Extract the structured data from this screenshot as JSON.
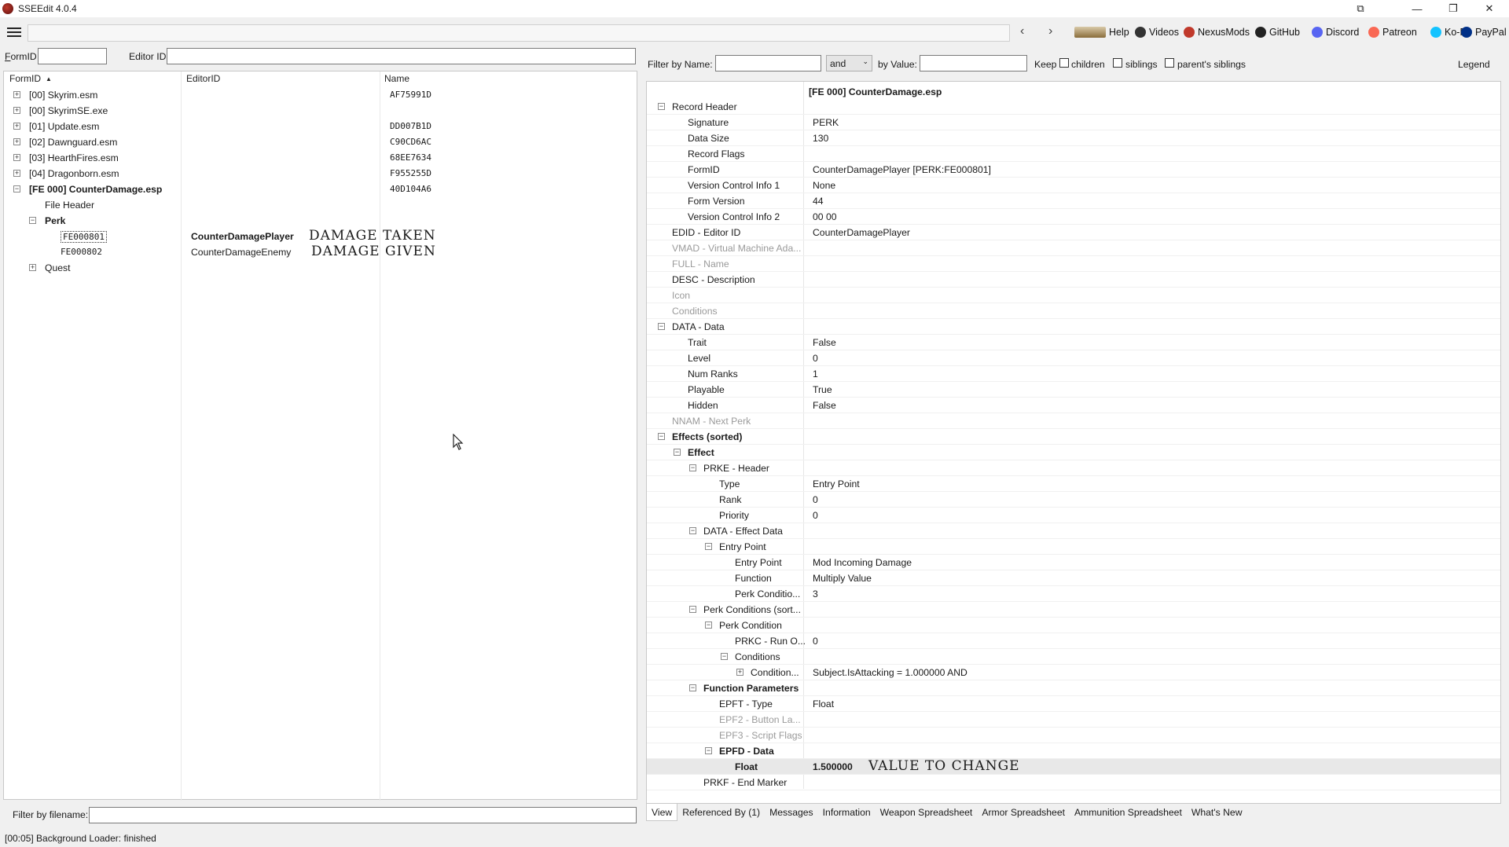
{
  "window": {
    "title": "SSEEdit 4.0.4",
    "minimize": "—",
    "restore": "❐",
    "close": "✕",
    "extra": "⧉"
  },
  "toolbar": {
    "links": [
      {
        "label": "Help",
        "icon": "book-icon"
      },
      {
        "label": "Videos",
        "icon": "videos-icon"
      },
      {
        "label": "NexusMods",
        "icon": "nexusmods-icon"
      },
      {
        "label": "GitHub",
        "icon": "github-icon"
      },
      {
        "label": "Discord",
        "icon": "discord-icon"
      },
      {
        "label": "Patreon",
        "icon": "patreon-icon"
      },
      {
        "label": "Ko-Fi",
        "icon": "kofi-icon"
      },
      {
        "label": "PayPal",
        "icon": "paypal-icon"
      }
    ],
    "back": "‹",
    "forward": "›"
  },
  "left_filters": {
    "formid_label": "FormID",
    "editorid_label": "Editor ID",
    "formid_value": "",
    "editorid_value": ""
  },
  "right_filters": {
    "name_label": "Filter by Name:",
    "and_label": "and",
    "value_label": "by Value:",
    "keep_label": "Keep",
    "children_label": "children",
    "siblings_label": "siblings",
    "parents_siblings_label": "parent's siblings",
    "legend_label": "Legend"
  },
  "left_tree": {
    "columns": [
      "FormID",
      "EditorID",
      "Name"
    ],
    "sort_indicator": "▲",
    "rows": [
      {
        "formid": "[00] Skyrim.esm",
        "editorid": "",
        "name": "AF75991D",
        "level": 0,
        "expander": "+"
      },
      {
        "formid": "[00] SkyrimSE.exe",
        "editorid": "",
        "name": "",
        "level": 0,
        "expander": "+"
      },
      {
        "formid": "[01] Update.esm",
        "editorid": "",
        "name": "DD007B1D",
        "level": 0,
        "expander": "+"
      },
      {
        "formid": "[02] Dawnguard.esm",
        "editorid": "",
        "name": "C90CD6AC",
        "level": 0,
        "expander": "+"
      },
      {
        "formid": "[03] HearthFires.esm",
        "editorid": "",
        "name": "68EE7634",
        "level": 0,
        "expander": "+"
      },
      {
        "formid": "[04] Dragonborn.esm",
        "editorid": "",
        "name": "F955255D",
        "level": 0,
        "expander": "+"
      },
      {
        "formid": "[FE 000] CounterDamage.esp",
        "editorid": "",
        "name": "40D104A6",
        "level": 0,
        "expander": "−",
        "bold": true
      },
      {
        "formid": "File Header",
        "editorid": "",
        "name": "",
        "level": 1,
        "expander": ""
      },
      {
        "formid": "Perk",
        "editorid": "",
        "name": "",
        "level": 1,
        "expander": "−",
        "bold": true
      },
      {
        "formid": "FE000801",
        "editorid": "CounterDamagePlayer",
        "name": "DAMAGE TAKEN",
        "level": 2,
        "expander": "",
        "selected": true
      },
      {
        "formid": "FE000802",
        "editorid": "CounterDamageEnemy",
        "name": "DAMAGE GIVEN",
        "level": 2,
        "expander": ""
      },
      {
        "formid": "Quest",
        "editorid": "",
        "name": "",
        "level": 1,
        "expander": "+"
      }
    ]
  },
  "filter_filename_label": "Filter by filename:",
  "record": {
    "header": "[FE 000] CounterDamage.esp",
    "rows": [
      {
        "label": "Record Header",
        "value": "",
        "level": 0,
        "expander": "−"
      },
      {
        "label": "Signature",
        "value": "PERK",
        "level": 1
      },
      {
        "label": "Data Size",
        "value": "130",
        "level": 1
      },
      {
        "label": "Record Flags",
        "value": "",
        "level": 1
      },
      {
        "label": "FormID",
        "value": "CounterDamagePlayer [PERK:FE000801]",
        "level": 1
      },
      {
        "label": "Version Control Info 1",
        "value": "None",
        "level": 1
      },
      {
        "label": "Form Version",
        "value": "44",
        "level": 1
      },
      {
        "label": "Version Control Info 2",
        "value": "00 00",
        "level": 1
      },
      {
        "label": "EDID - Editor ID",
        "value": "CounterDamagePlayer",
        "level": 0
      },
      {
        "label": "VMAD - Virtual Machine Ada...",
        "value": "",
        "level": 0,
        "grey": true
      },
      {
        "label": "FULL - Name",
        "value": "",
        "level": 0,
        "grey": true
      },
      {
        "label": "DESC - Description",
        "value": "",
        "level": 0
      },
      {
        "label": "Icon",
        "value": "",
        "level": 0,
        "grey": true
      },
      {
        "label": "Conditions",
        "value": "",
        "level": 0,
        "grey": true
      },
      {
        "label": "DATA - Data",
        "value": "",
        "level": 0,
        "expander": "−"
      },
      {
        "label": "Trait",
        "value": "False",
        "level": 1
      },
      {
        "label": "Level",
        "value": "0",
        "level": 1
      },
      {
        "label": "Num Ranks",
        "value": "1",
        "level": 1
      },
      {
        "label": "Playable",
        "value": "True",
        "level": 1
      },
      {
        "label": "Hidden",
        "value": "False",
        "level": 1
      },
      {
        "label": "NNAM - Next Perk",
        "value": "",
        "level": 0,
        "grey": true
      },
      {
        "label": "Effects (sorted)",
        "value": "",
        "level": 0,
        "expander": "−",
        "bold": true
      },
      {
        "label": "Effect",
        "value": "",
        "level": 1,
        "expander": "−",
        "bold": true
      },
      {
        "label": "PRKE - Header",
        "value": "",
        "level": 2,
        "expander": "−"
      },
      {
        "label": "Type",
        "value": "Entry Point",
        "level": 3
      },
      {
        "label": "Rank",
        "value": "0",
        "level": 3
      },
      {
        "label": "Priority",
        "value": "0",
        "level": 3
      },
      {
        "label": "DATA - Effect Data",
        "value": "",
        "level": 2,
        "expander": "−"
      },
      {
        "label": "Entry Point",
        "value": "",
        "level": 3,
        "expander": "−"
      },
      {
        "label": "Entry Point",
        "value": "Mod Incoming Damage",
        "level": 4
      },
      {
        "label": "Function",
        "value": "Multiply Value",
        "level": 4
      },
      {
        "label": "Perk Conditio...",
        "value": "3",
        "level": 4
      },
      {
        "label": "Perk Conditions (sort...",
        "value": "",
        "level": 2,
        "expander": "−"
      },
      {
        "label": "Perk Condition",
        "value": "",
        "level": 3,
        "expander": "−"
      },
      {
        "label": "PRKC - Run O...",
        "value": "0",
        "level": 4
      },
      {
        "label": "Conditions",
        "value": "",
        "level": 4,
        "expander": "−"
      },
      {
        "label": "Condition...",
        "value": "Subject.IsAttacking = 1.000000 AND",
        "level": 5,
        "expander": "+"
      },
      {
        "label": "Function Parameters",
        "value": "",
        "level": 2,
        "expander": "−",
        "bold": true
      },
      {
        "label": "EPFT - Type",
        "value": "Float",
        "level": 3
      },
      {
        "label": "EPF2 - Button La...",
        "value": "",
        "level": 3,
        "grey": true
      },
      {
        "label": "EPF3 - Script Flags",
        "value": "",
        "level": 3,
        "grey": true
      },
      {
        "label": "EPFD - Data",
        "value": "",
        "level": 3,
        "expander": "−",
        "bold": true
      },
      {
        "label": "Float",
        "value": "1.500000",
        "level": 4,
        "bold": true,
        "highlight": true,
        "note": "VALUE TO CHANGE"
      },
      {
        "label": "PRKF - End Marker",
        "value": "",
        "level": 2
      }
    ]
  },
  "tabs": [
    "View",
    "Referenced By (1)",
    "Messages",
    "Information",
    "Weapon Spreadsheet",
    "Armor Spreadsheet",
    "Ammunition Spreadsheet",
    "What's New"
  ],
  "status": "[00:05] Background Loader: finished"
}
